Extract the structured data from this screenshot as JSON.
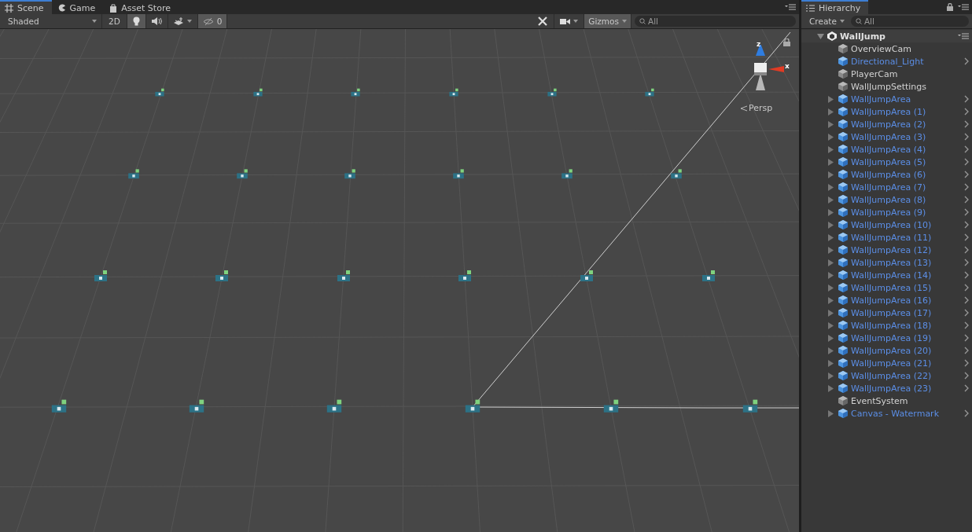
{
  "scene_tabs": [
    {
      "label": "Scene",
      "kind": "grid",
      "selected": true
    },
    {
      "label": "Game",
      "kind": "pacman",
      "selected": false
    },
    {
      "label": "Asset Store",
      "kind": "bag",
      "selected": false
    }
  ],
  "scene_toolbar": {
    "shading_mode": "Shaded",
    "mode_2d": "2D",
    "lighting_on": true,
    "audio_on": false,
    "hidden_count": "0",
    "gizmos": "Gizmos",
    "search_placeholder": "All"
  },
  "gizmo": {
    "axis_x": "x",
    "axis_z": "z",
    "projection": "Persp"
  },
  "hierarchy": {
    "title": "Hierarchy",
    "create": "Create",
    "search_placeholder": "All",
    "scene": {
      "name": "WallJump",
      "expanded": true
    },
    "items": [
      {
        "name": "OverviewCam",
        "prefab": false,
        "has_children": false
      },
      {
        "name": "Directional_Light",
        "prefab": true,
        "has_children": false
      },
      {
        "name": "PlayerCam",
        "prefab": false,
        "has_children": false
      },
      {
        "name": "WallJumpSettings",
        "prefab": false,
        "has_children": false
      },
      {
        "name": "WallJumpArea",
        "prefab": true,
        "has_children": true
      },
      {
        "name": "WallJumpArea (1)",
        "prefab": true,
        "has_children": true
      },
      {
        "name": "WallJumpArea (2)",
        "prefab": true,
        "has_children": true
      },
      {
        "name": "WallJumpArea (3)",
        "prefab": true,
        "has_children": true
      },
      {
        "name": "WallJumpArea (4)",
        "prefab": true,
        "has_children": true
      },
      {
        "name": "WallJumpArea (5)",
        "prefab": true,
        "has_children": true
      },
      {
        "name": "WallJumpArea (6)",
        "prefab": true,
        "has_children": true
      },
      {
        "name": "WallJumpArea (7)",
        "prefab": true,
        "has_children": true
      },
      {
        "name": "WallJumpArea (8)",
        "prefab": true,
        "has_children": true
      },
      {
        "name": "WallJumpArea (9)",
        "prefab": true,
        "has_children": true
      },
      {
        "name": "WallJumpArea (10)",
        "prefab": true,
        "has_children": true
      },
      {
        "name": "WallJumpArea (11)",
        "prefab": true,
        "has_children": true
      },
      {
        "name": "WallJumpArea (12)",
        "prefab": true,
        "has_children": true
      },
      {
        "name": "WallJumpArea (13)",
        "prefab": true,
        "has_children": true
      },
      {
        "name": "WallJumpArea (14)",
        "prefab": true,
        "has_children": true
      },
      {
        "name": "WallJumpArea (15)",
        "prefab": true,
        "has_children": true
      },
      {
        "name": "WallJumpArea (16)",
        "prefab": true,
        "has_children": true
      },
      {
        "name": "WallJumpArea (17)",
        "prefab": true,
        "has_children": true
      },
      {
        "name": "WallJumpArea (18)",
        "prefab": true,
        "has_children": true
      },
      {
        "name": "WallJumpArea (19)",
        "prefab": true,
        "has_children": true
      },
      {
        "name": "WallJumpArea (20)",
        "prefab": true,
        "has_children": true
      },
      {
        "name": "WallJumpArea (21)",
        "prefab": true,
        "has_children": true
      },
      {
        "name": "WallJumpArea (22)",
        "prefab": true,
        "has_children": true
      },
      {
        "name": "WallJumpArea (23)",
        "prefab": true,
        "has_children": true
      },
      {
        "name": "EventSystem",
        "prefab": false,
        "has_children": false
      },
      {
        "name": "Canvas - Watermark",
        "prefab": true,
        "has_children": true
      }
    ]
  }
}
